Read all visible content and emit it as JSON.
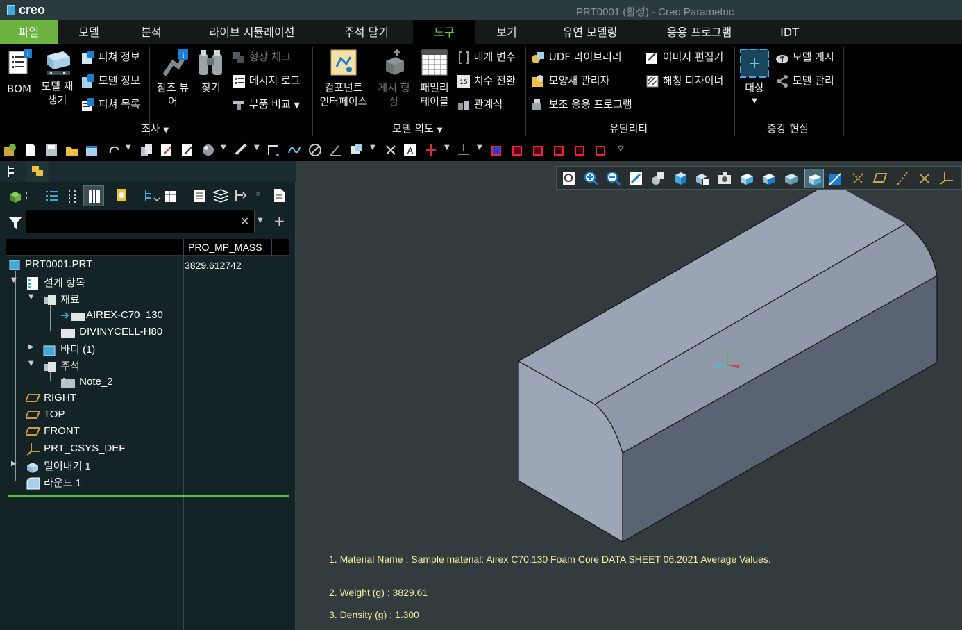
{
  "app": {
    "logo": "creo",
    "window_title": "PRT0001 (활성) - Creo Parametric"
  },
  "tabs": [
    "파일",
    "모델",
    "분석",
    "라이브 시뮬레이션",
    "주석 달기",
    "도구",
    "보기",
    "유연 모델링",
    "응용 프로그램",
    "IDT"
  ],
  "ribbon": {
    "bom": "BOM",
    "model_player_1": "모델 재",
    "model_player_2": "생기",
    "feature_info": "피쳐 정보",
    "model_info": "모델 정보",
    "feature_list": "피쳐 목록",
    "ref_viewer_1": "참조 뷰",
    "ref_viewer_2": "어",
    "find": "찾기",
    "geom_check": "형상 체크",
    "message_log": "메시지 로그",
    "compare_part": "부품 비교",
    "component_if_1": "컴포넌트",
    "component_if_2": "인터페이스",
    "publish_geom_1": "게시 형",
    "publish_geom_2": "상",
    "family_table_1": "패밀리",
    "family_table_2": "테이블",
    "params": "매개 변수",
    "dim_switch": "치수 전환",
    "relations": "관계식",
    "udf_library": "UDF 라이브러리",
    "appearance_mgr": "모양새 관리자",
    "aux_apps": "보조 응용 프로그램",
    "image_editor": "이미지 편집기",
    "hatch_designer": "해칭 디자이너",
    "target": "대상",
    "model_publish": "모델 게시",
    "model_manage": "모델 관리",
    "group_investigate": "조사",
    "group_model_intent": "모델 의도",
    "group_utilities": "유틸리티",
    "group_ar": "증강 현실"
  },
  "tree": {
    "column_header": "PRO_MP_MASS",
    "search_value": "",
    "root": "PRT0001.PRT",
    "root_mass": "3829.612742",
    "design_items": "설계 항목",
    "materials": "재료",
    "material_1": "AIREX-C70_130",
    "material_2": "DIVINYCELL-H80",
    "bodies": "바디 (1)",
    "annotations": "주석",
    "note": "Note_2",
    "right": "RIGHT",
    "top": "TOP",
    "front": "FRONT",
    "csys": "PRT_CSYS_DEF",
    "extrude": "밀어내기 1",
    "round": "라운드 1"
  },
  "notes": {
    "line1": "1. Material Name : Sample material: Airex C70.130 Foam Core DATA SHEET 06.2021 Average Values.",
    "line2": "2. Weight (g) : 3829.61",
    "line3": "3. Density (g) :  1.300"
  },
  "colors": {
    "accent_green": "#6cb33f",
    "active_tab_text": "#76c043",
    "note_text": "#f4ef9a",
    "part_top": "#9aa5b5",
    "part_front": "#7c8799",
    "part_side": "#596271"
  }
}
